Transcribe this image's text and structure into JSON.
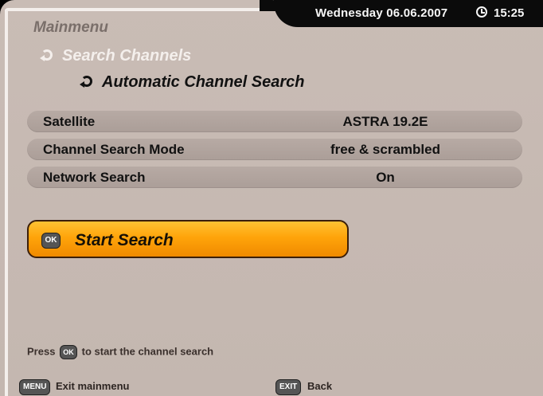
{
  "header": {
    "date": "Wednesday 06.06.2007",
    "time": "15:25"
  },
  "title": "Mainmenu",
  "breadcrumbs": [
    "Search Channels",
    "Automatic Channel Search"
  ],
  "settings": [
    {
      "label": "Satellite",
      "value": "ASTRA 19.2E"
    },
    {
      "label": "Channel Search Mode",
      "value": "free & scrambled"
    },
    {
      "label": "Network Search",
      "value": "On"
    }
  ],
  "start_button": {
    "key": "OK",
    "label": "Start Search"
  },
  "hint": {
    "prefix": "Press",
    "key": "OK",
    "suffix": "to start the channel search"
  },
  "footer": {
    "menu_key": "MENU",
    "menu_label": "Exit mainmenu",
    "exit_key": "EXIT",
    "exit_label": "Back"
  },
  "colors": {
    "background": "#c6b9b2",
    "header_bar": "#0b0b0b",
    "button_orange": "#ffa40a"
  }
}
